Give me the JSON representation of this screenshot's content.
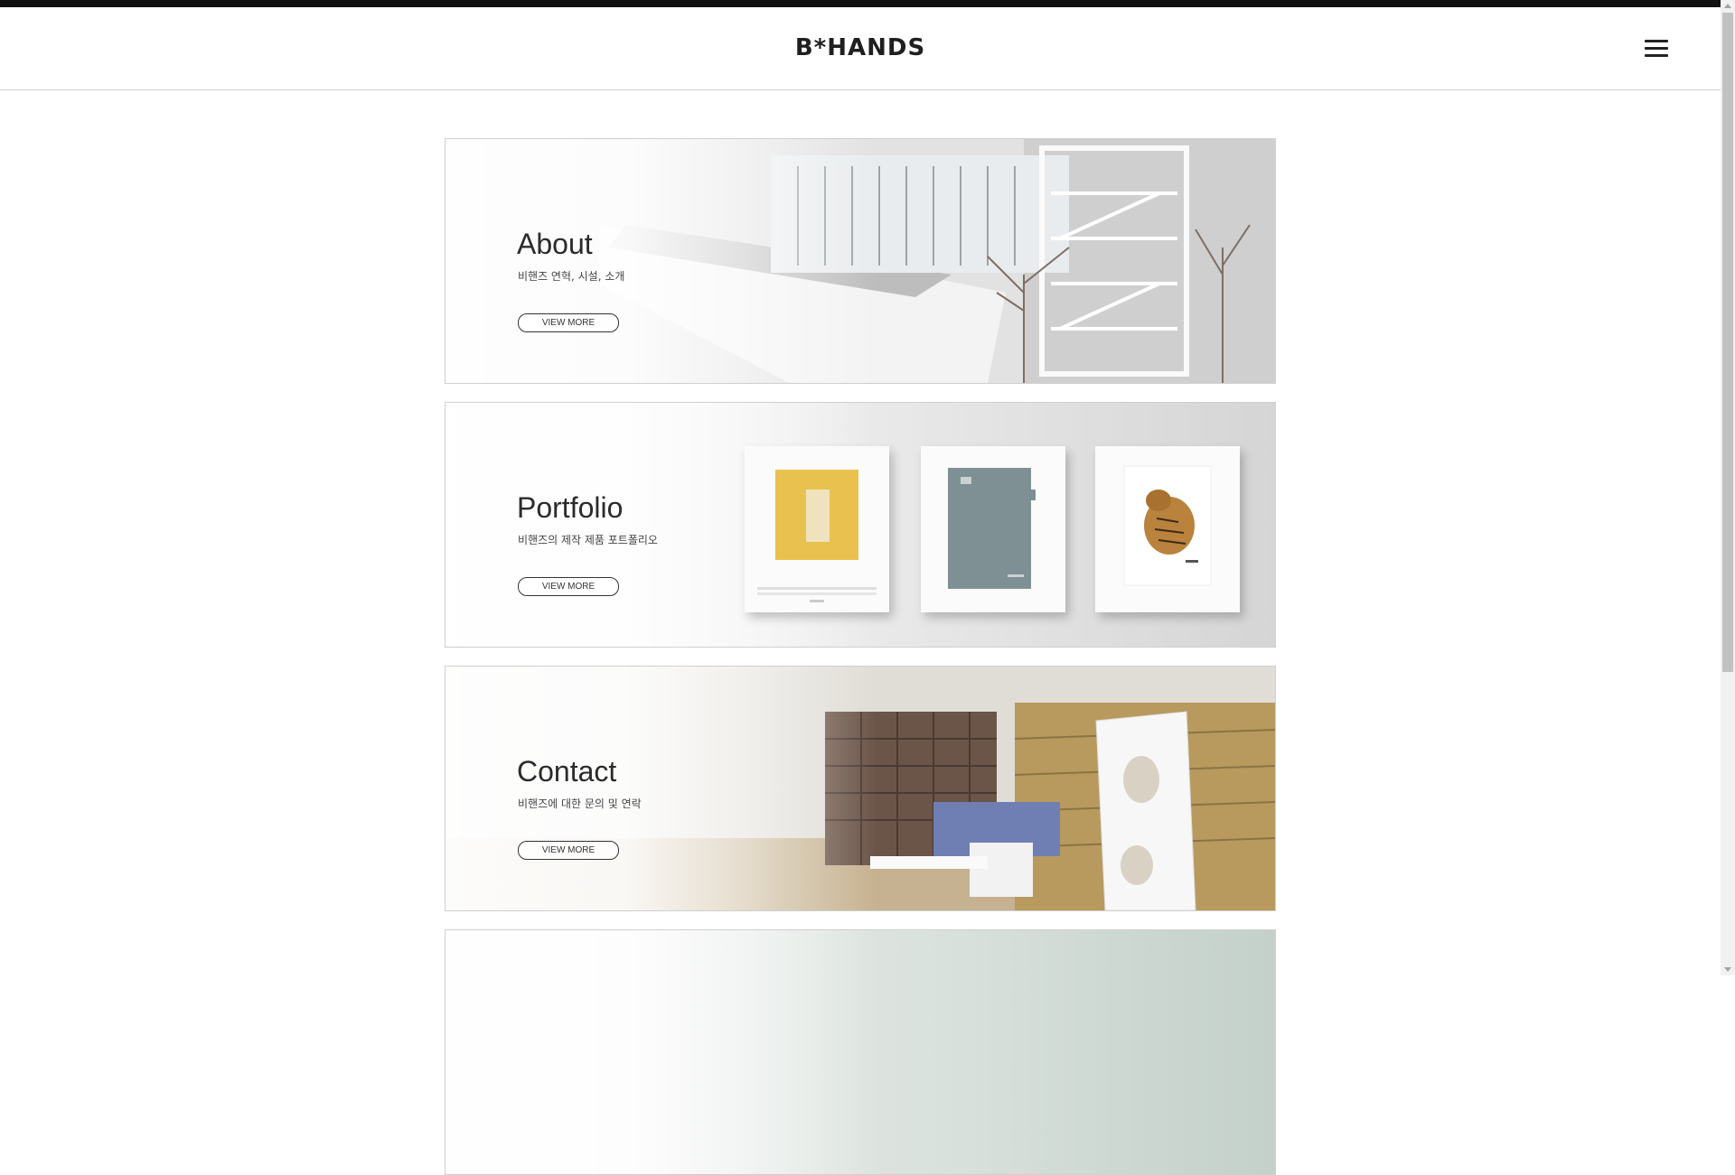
{
  "header": {
    "logo": "B*HANDS",
    "menu_icon": "hamburger-icon"
  },
  "cards": [
    {
      "title": "About",
      "subtitle": "비핸즈 연혁, 시설, 소개",
      "button": "VIEW MORE"
    },
    {
      "title": "Portfolio",
      "subtitle": "비핸즈의 제작 제품 포트폴리오",
      "button": "VIEW MORE"
    },
    {
      "title": "Contact",
      "subtitle": "비핸즈에 대한 문의 및 연락",
      "button": "VIEW MORE"
    }
  ],
  "colors": {
    "top_bar": "#111111",
    "text": "#2b2b2b",
    "border": "#cfcfcf"
  }
}
